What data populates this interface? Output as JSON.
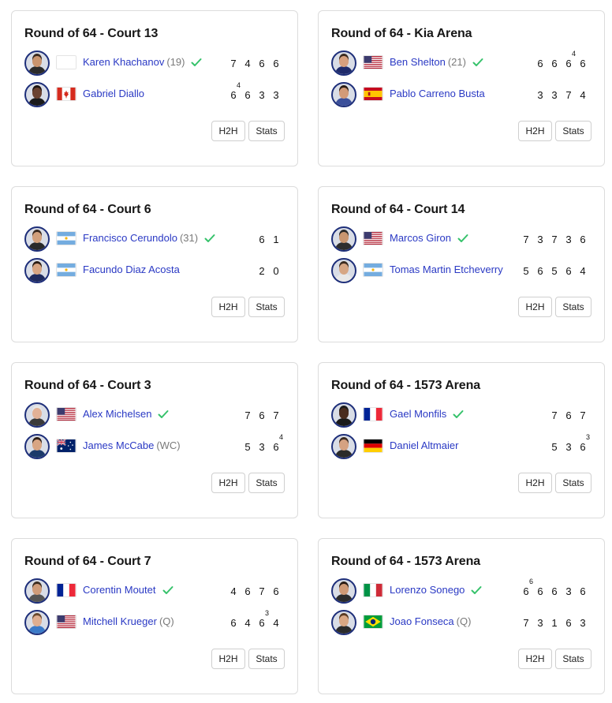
{
  "check_color": "#36c26b",
  "name_color": "#2a39c4",
  "matches": [
    {
      "title": "Round of 64 - Court 13",
      "players": [
        {
          "name": "Karen Khachanov",
          "seed": "(19)",
          "flag": "none",
          "winner": true,
          "skin": "#c9946e",
          "hair": "#3a2a20",
          "shirt": "#2b2b2b",
          "scores": [
            {
              "v": "7",
              "tb": ""
            },
            {
              "v": "4",
              "tb": ""
            },
            {
              "v": "6",
              "tb": ""
            },
            {
              "v": "6",
              "tb": ""
            }
          ]
        },
        {
          "name": "Gabriel Diallo",
          "seed": "",
          "flag": "ca",
          "winner": false,
          "skin": "#6b4230",
          "hair": "#1d1410",
          "shirt": "#1b1b1b",
          "scores": [
            {
              "v": "6",
              "tb": "4"
            },
            {
              "v": "6",
              "tb": ""
            },
            {
              "v": "3",
              "tb": ""
            },
            {
              "v": "3",
              "tb": ""
            }
          ]
        }
      ],
      "h2h": "H2H",
      "stats": "Stats"
    },
    {
      "title": "Round of 64 - Kia Arena",
      "players": [
        {
          "name": "Ben Shelton",
          "seed": "(21)",
          "flag": "us",
          "winner": true,
          "skin": "#d7a07e",
          "hair": "#3b2a1f",
          "shirt": "#1f2b6b",
          "scores": [
            {
              "v": "6",
              "tb": ""
            },
            {
              "v": "6",
              "tb": ""
            },
            {
              "v": "6",
              "tb": "4"
            },
            {
              "v": "6",
              "tb": ""
            }
          ]
        },
        {
          "name": "Pablo Carreno Busta",
          "seed": "",
          "flag": "es",
          "winner": false,
          "skin": "#d39b78",
          "hair": "#2a1c14",
          "shirt": "#3b4f9a",
          "scores": [
            {
              "v": "3",
              "tb": ""
            },
            {
              "v": "3",
              "tb": ""
            },
            {
              "v": "7",
              "tb": ""
            },
            {
              "v": "4",
              "tb": ""
            }
          ]
        }
      ],
      "h2h": "H2H",
      "stats": "Stats"
    },
    {
      "title": "Round of 64 - Court 6",
      "players": [
        {
          "name": "Francisco Cerundolo",
          "seed": "(31)",
          "flag": "ar",
          "winner": true,
          "skin": "#d2a07c",
          "hair": "#3a2a20",
          "shirt": "#2a2a2a",
          "scores": [
            {
              "v": "6",
              "tb": ""
            },
            {
              "v": "1",
              "tb": ""
            }
          ]
        },
        {
          "name": "Facundo Diaz Acosta",
          "seed": "",
          "flag": "ar",
          "winner": false,
          "skin": "#d7a583",
          "hair": "#2b1d15",
          "shirt": "#1e2a5e",
          "scores": [
            {
              "v": "2",
              "tb": ""
            },
            {
              "v": "0",
              "tb": ""
            }
          ]
        }
      ],
      "h2h": "H2H",
      "stats": "Stats"
    },
    {
      "title": "Round of 64 - Court 14",
      "players": [
        {
          "name": "Marcos Giron",
          "seed": "",
          "flag": "us",
          "winner": true,
          "skin": "#c99670",
          "hair": "#2a2a2a",
          "shirt": "#2e2e2e",
          "scores": [
            {
              "v": "7",
              "tb": ""
            },
            {
              "v": "3",
              "tb": ""
            },
            {
              "v": "7",
              "tb": ""
            },
            {
              "v": "3",
              "tb": ""
            },
            {
              "v": "6",
              "tb": ""
            }
          ]
        },
        {
          "name": "Tomas Martin Etcheverry",
          "seed": "",
          "flag": "ar",
          "winner": false,
          "skin": "#d6a684",
          "hair": "#3b2b20",
          "shirt": "#e8e8e8",
          "scores": [
            {
              "v": "5",
              "tb": ""
            },
            {
              "v": "6",
              "tb": ""
            },
            {
              "v": "5",
              "tb": ""
            },
            {
              "v": "6",
              "tb": ""
            },
            {
              "v": "4",
              "tb": ""
            }
          ]
        }
      ],
      "h2h": "H2H",
      "stats": "Stats"
    },
    {
      "title": "Round of 64 - Court 3",
      "players": [
        {
          "name": "Alex Michelsen",
          "seed": "",
          "flag": "us",
          "winner": true,
          "skin": "#e2b196",
          "hair": "#e6e6e6",
          "shirt": "#3a3a3a",
          "scores": [
            {
              "v": "7",
              "tb": ""
            },
            {
              "v": "6",
              "tb": ""
            },
            {
              "v": "7",
              "tb": ""
            }
          ]
        },
        {
          "name": "James McCabe",
          "seed": "(WC)",
          "flag": "au",
          "winner": false,
          "skin": "#d8a583",
          "hair": "#2c1e16",
          "shirt": "#1c3a6a",
          "scores": [
            {
              "v": "5",
              "tb": ""
            },
            {
              "v": "3",
              "tb": ""
            },
            {
              "v": "6",
              "tb": "4"
            }
          ]
        }
      ],
      "h2h": "H2H",
      "stats": "Stats"
    },
    {
      "title": "Round of 64 - 1573 Arena",
      "players": [
        {
          "name": "Gael Monfils",
          "seed": "",
          "flag": "fr",
          "winner": true,
          "skin": "#4a2c1e",
          "hair": "#1a1a1a",
          "shirt": "#1a1a1a",
          "scores": [
            {
              "v": "7",
              "tb": ""
            },
            {
              "v": "6",
              "tb": ""
            },
            {
              "v": "7",
              "tb": ""
            }
          ]
        },
        {
          "name": "Daniel Altmaier",
          "seed": "",
          "flag": "de",
          "winner": false,
          "skin": "#d5a282",
          "hair": "#3b2a20",
          "shirt": "#2a2a2a",
          "scores": [
            {
              "v": "5",
              "tb": ""
            },
            {
              "v": "3",
              "tb": ""
            },
            {
              "v": "6",
              "tb": "3"
            }
          ]
        }
      ],
      "h2h": "H2H",
      "stats": "Stats"
    },
    {
      "title": "Round of 64 - Court 7",
      "players": [
        {
          "name": "Corentin Moutet",
          "seed": "",
          "flag": "fr",
          "winner": true,
          "skin": "#cf9c7a",
          "hair": "#3c2d22",
          "shirt": "#555555",
          "scores": [
            {
              "v": "4",
              "tb": ""
            },
            {
              "v": "6",
              "tb": ""
            },
            {
              "v": "7",
              "tb": ""
            },
            {
              "v": "6",
              "tb": ""
            }
          ]
        },
        {
          "name": "Mitchell Krueger",
          "seed": "(Q)",
          "flag": "us",
          "winner": false,
          "skin": "#dfae90",
          "hair": "#6a4a2e",
          "shirt": "#3b7ac8",
          "scores": [
            {
              "v": "6",
              "tb": ""
            },
            {
              "v": "4",
              "tb": ""
            },
            {
              "v": "6",
              "tb": "3"
            },
            {
              "v": "4",
              "tb": ""
            }
          ]
        }
      ],
      "h2h": "H2H",
      "stats": "Stats"
    },
    {
      "title": "Round of 64 - 1573 Arena",
      "players": [
        {
          "name": "Lorenzo Sonego",
          "seed": "",
          "flag": "it",
          "winner": true,
          "skin": "#cf9a76",
          "hair": "#2a1c14",
          "shirt": "#2c2c2c",
          "scores": [
            {
              "v": "6",
              "tb": "6"
            },
            {
              "v": "6",
              "tb": ""
            },
            {
              "v": "6",
              "tb": ""
            },
            {
              "v": "3",
              "tb": ""
            },
            {
              "v": "6",
              "tb": ""
            }
          ]
        },
        {
          "name": "Joao Fonseca",
          "seed": "(Q)",
          "flag": "br",
          "winner": false,
          "skin": "#d9a784",
          "hair": "#5a3a22",
          "shirt": "#2b2b2b",
          "scores": [
            {
              "v": "7",
              "tb": ""
            },
            {
              "v": "3",
              "tb": ""
            },
            {
              "v": "1",
              "tb": ""
            },
            {
              "v": "6",
              "tb": ""
            },
            {
              "v": "3",
              "tb": ""
            }
          ]
        }
      ],
      "h2h": "H2H",
      "stats": "Stats"
    }
  ]
}
